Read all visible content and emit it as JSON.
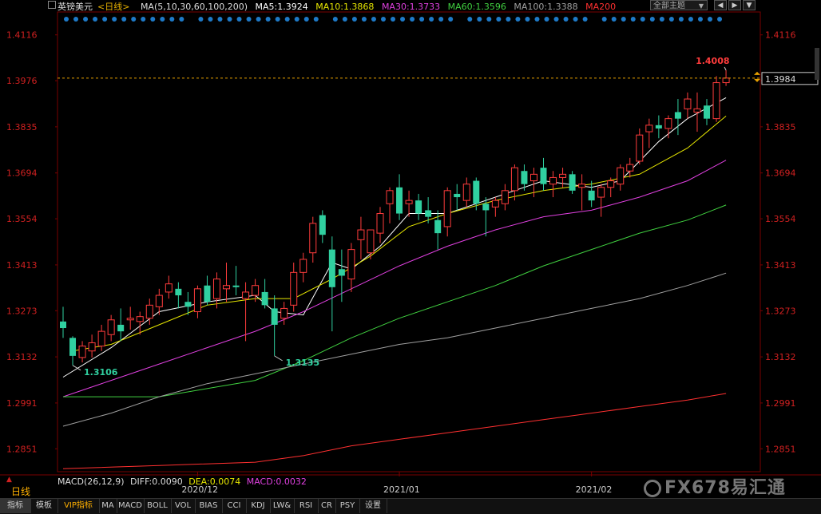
{
  "header": {
    "symbol": "英镑美元",
    "period": "<日线>",
    "ma_params": "MA(5,10,30,60,100,200)",
    "ma5": "MA5:1.3924",
    "ma10": "MA10:1.3868",
    "ma30": "MA30:1.3733",
    "ma60": "MA60:1.3596",
    "ma100": "MA100:1.3388",
    "ma200": "MA200",
    "theme_button": "全部主题",
    "colors": {
      "ma5": "#ffffff",
      "ma10": "#e6e600",
      "ma30": "#e040e0",
      "ma60": "#40d040",
      "ma100": "#a0a0a0",
      "ma200": "#ff3030"
    }
  },
  "macd": {
    "label": "MACD(26,12,9)",
    "diff": "DIFF:0.0090",
    "dea": "DEA:0.0074",
    "macd": "MACD:0.0032"
  },
  "period_label": "日线",
  "logo": "FX678易汇通",
  "bottom_tabs": [
    "指标",
    "模板",
    "VIP指标",
    "MA",
    "MACD",
    "BOLL",
    "VOL",
    "BIAS",
    "CCI",
    "KDJ",
    "LW&",
    "RSI",
    "CR",
    "PSY",
    "设置"
  ],
  "chart_data": {
    "type": "candlestick",
    "ylim": [
      1.2781,
      1.4186
    ],
    "y_ticks": [
      "1.4116",
      "1.3976",
      "1.3835",
      "1.3694",
      "1.3554",
      "1.3413",
      "1.3273",
      "1.3132",
      "1.2991",
      "1.2851"
    ],
    "x_labels": [
      {
        "text": "2020/12",
        "index": 14
      },
      {
        "text": "2021/01",
        "index": 35
      },
      {
        "text": "2021/02",
        "index": 55
      }
    ],
    "current_price": "1.3984",
    "current_price_value": 1.3984,
    "annotations": [
      {
        "text": "1.3106",
        "index": 1,
        "value": 1.3106
      },
      {
        "text": "1.3135",
        "index": 22,
        "value": 1.3135
      },
      {
        "text": "1.4008",
        "index": 69,
        "value": 1.4008
      }
    ],
    "candles": [
      [
        1.324,
        1.3285,
        1.319,
        1.322
      ],
      [
        1.319,
        1.3195,
        1.3106,
        1.3135
      ],
      [
        1.313,
        1.318,
        1.3115,
        1.3165
      ],
      [
        1.315,
        1.32,
        1.313,
        1.3175
      ],
      [
        1.3165,
        1.323,
        1.315,
        1.321
      ],
      [
        1.32,
        1.326,
        1.318,
        1.3245
      ],
      [
        1.323,
        1.328,
        1.318,
        1.321
      ],
      [
        1.3245,
        1.3285,
        1.3215,
        1.325
      ],
      [
        1.324,
        1.327,
        1.32,
        1.3255
      ],
      [
        1.325,
        1.331,
        1.323,
        1.329
      ],
      [
        1.3285,
        1.334,
        1.326,
        1.332
      ],
      [
        1.333,
        1.338,
        1.331,
        1.3355
      ],
      [
        1.334,
        1.336,
        1.328,
        1.332
      ],
      [
        1.33,
        1.333,
        1.326,
        1.3285
      ],
      [
        1.327,
        1.335,
        1.325,
        1.334
      ],
      [
        1.335,
        1.338,
        1.329,
        1.33
      ],
      [
        1.331,
        1.339,
        1.328,
        1.337
      ],
      [
        1.334,
        1.342,
        1.33,
        1.335
      ],
      [
        1.335,
        1.341,
        1.332,
        1.3345
      ],
      [
        1.331,
        1.336,
        1.318,
        1.333
      ],
      [
        1.332,
        1.337,
        1.33,
        1.335
      ],
      [
        1.333,
        1.337,
        1.328,
        1.329
      ],
      [
        1.328,
        1.332,
        1.3135,
        1.323
      ],
      [
        1.325,
        1.33,
        1.323,
        1.328
      ],
      [
        1.329,
        1.342,
        1.327,
        1.339
      ],
      [
        1.339,
        1.345,
        1.336,
        1.343
      ],
      [
        1.345,
        1.356,
        1.342,
        1.354
      ],
      [
        1.3565,
        1.358,
        1.348,
        1.3505
      ],
      [
        1.346,
        1.35,
        1.321,
        1.3345
      ],
      [
        1.34,
        1.346,
        1.33,
        1.338
      ],
      [
        1.337,
        1.348,
        1.333,
        1.346
      ],
      [
        1.349,
        1.356,
        1.343,
        1.352
      ],
      [
        1.345,
        1.352,
        1.343,
        1.352
      ],
      [
        1.351,
        1.359,
        1.348,
        1.357
      ],
      [
        1.36,
        1.365,
        1.354,
        1.364
      ],
      [
        1.365,
        1.369,
        1.355,
        1.357
      ],
      [
        1.36,
        1.364,
        1.356,
        1.361
      ],
      [
        1.361,
        1.363,
        1.355,
        1.357
      ],
      [
        1.358,
        1.362,
        1.354,
        1.356
      ],
      [
        1.355,
        1.358,
        1.346,
        1.351
      ],
      [
        1.353,
        1.365,
        1.35,
        1.364
      ],
      [
        1.363,
        1.366,
        1.358,
        1.362
      ],
      [
        1.361,
        1.368,
        1.359,
        1.366
      ],
      [
        1.367,
        1.368,
        1.358,
        1.36
      ],
      [
        1.36,
        1.362,
        1.35,
        1.358
      ],
      [
        1.359,
        1.362,
        1.356,
        1.361
      ],
      [
        1.36,
        1.366,
        1.358,
        1.364
      ],
      [
        1.364,
        1.372,
        1.361,
        1.371
      ],
      [
        1.37,
        1.372,
        1.364,
        1.366
      ],
      [
        1.367,
        1.371,
        1.362,
        1.369
      ],
      [
        1.371,
        1.374,
        1.364,
        1.366
      ],
      [
        1.366,
        1.37,
        1.362,
        1.368
      ],
      [
        1.368,
        1.371,
        1.365,
        1.369
      ],
      [
        1.369,
        1.37,
        1.363,
        1.364
      ],
      [
        1.365,
        1.369,
        1.358,
        1.366
      ],
      [
        1.364,
        1.367,
        1.359,
        1.361
      ],
      [
        1.362,
        1.366,
        1.356,
        1.365
      ],
      [
        1.365,
        1.368,
        1.362,
        1.367
      ],
      [
        1.366,
        1.372,
        1.364,
        1.371
      ],
      [
        1.37,
        1.374,
        1.368,
        1.372
      ],
      [
        1.373,
        1.383,
        1.372,
        1.381
      ],
      [
        1.382,
        1.386,
        1.377,
        1.384
      ],
      [
        1.384,
        1.387,
        1.38,
        1.383
      ],
      [
        1.383,
        1.387,
        1.38,
        1.386
      ],
      [
        1.388,
        1.392,
        1.381,
        1.386
      ],
      [
        1.389,
        1.394,
        1.386,
        1.392
      ],
      [
        1.388,
        1.394,
        1.382,
        1.389
      ],
      [
        1.39,
        1.392,
        1.384,
        1.386
      ],
      [
        1.386,
        1.399,
        1.385,
        1.397
      ],
      [
        1.397,
        1.4008,
        1.396,
        1.3984
      ]
    ],
    "series": [
      {
        "name": "MA5",
        "color": "#ffffff",
        "values": [
          [
            0,
            1.307
          ],
          [
            5,
            1.316
          ],
          [
            10,
            1.327
          ],
          [
            15,
            1.33
          ],
          [
            20,
            1.332
          ],
          [
            22,
            1.327
          ],
          [
            25,
            1.326
          ],
          [
            28,
            1.342
          ],
          [
            30,
            1.34
          ],
          [
            33,
            1.347
          ],
          [
            36,
            1.357
          ],
          [
            40,
            1.357
          ],
          [
            45,
            1.362
          ],
          [
            50,
            1.367
          ],
          [
            55,
            1.365
          ],
          [
            58,
            1.367
          ],
          [
            62,
            1.379
          ],
          [
            65,
            1.386
          ],
          [
            69,
            1.3924
          ]
        ]
      },
      {
        "name": "MA10",
        "color": "#e6e600",
        "values": [
          [
            1,
            1.315
          ],
          [
            5,
            1.317
          ],
          [
            10,
            1.323
          ],
          [
            15,
            1.329
          ],
          [
            20,
            1.331
          ],
          [
            24,
            1.331
          ],
          [
            28,
            1.337
          ],
          [
            32,
            1.344
          ],
          [
            36,
            1.353
          ],
          [
            40,
            1.357
          ],
          [
            45,
            1.361
          ],
          [
            50,
            1.364
          ],
          [
            55,
            1.366
          ],
          [
            60,
            1.369
          ],
          [
            65,
            1.377
          ],
          [
            69,
            1.3868
          ]
        ]
      },
      {
        "name": "MA30",
        "color": "#e040e0",
        "values": [
          [
            0,
            1.301
          ],
          [
            5,
            1.306
          ],
          [
            10,
            1.311
          ],
          [
            15,
            1.316
          ],
          [
            20,
            1.321
          ],
          [
            25,
            1.327
          ],
          [
            30,
            1.334
          ],
          [
            35,
            1.341
          ],
          [
            40,
            1.347
          ],
          [
            45,
            1.352
          ],
          [
            50,
            1.356
          ],
          [
            55,
            1.358
          ],
          [
            60,
            1.362
          ],
          [
            65,
            1.367
          ],
          [
            69,
            1.3733
          ]
        ]
      },
      {
        "name": "MA60",
        "color": "#40d040",
        "values": [
          [
            0,
            1.301
          ],
          [
            10,
            1.301
          ],
          [
            20,
            1.306
          ],
          [
            25,
            1.312
          ],
          [
            30,
            1.319
          ],
          [
            35,
            1.325
          ],
          [
            40,
            1.33
          ],
          [
            45,
            1.335
          ],
          [
            50,
            1.341
          ],
          [
            55,
            1.346
          ],
          [
            60,
            1.351
          ],
          [
            65,
            1.355
          ],
          [
            69,
            1.3596
          ]
        ]
      },
      {
        "name": "MA100",
        "color": "#a0a0a0",
        "values": [
          [
            0,
            1.292
          ],
          [
            5,
            1.296
          ],
          [
            10,
            1.301
          ],
          [
            15,
            1.305
          ],
          [
            20,
            1.308
          ],
          [
            25,
            1.311
          ],
          [
            30,
            1.314
          ],
          [
            35,
            1.317
          ],
          [
            40,
            1.319
          ],
          [
            45,
            1.322
          ],
          [
            50,
            1.325
          ],
          [
            55,
            1.328
          ],
          [
            60,
            1.331
          ],
          [
            65,
            1.335
          ],
          [
            69,
            1.3388
          ]
        ]
      },
      {
        "name": "MA200",
        "color": "#ff3030",
        "values": [
          [
            0,
            1.279
          ],
          [
            10,
            1.28
          ],
          [
            20,
            1.281
          ],
          [
            25,
            1.283
          ],
          [
            30,
            1.286
          ],
          [
            35,
            1.288
          ],
          [
            40,
            1.29
          ],
          [
            45,
            1.292
          ],
          [
            50,
            1.294
          ],
          [
            55,
            1.296
          ],
          [
            60,
            1.298
          ],
          [
            65,
            1.3
          ],
          [
            69,
            1.302
          ]
        ]
      }
    ]
  }
}
